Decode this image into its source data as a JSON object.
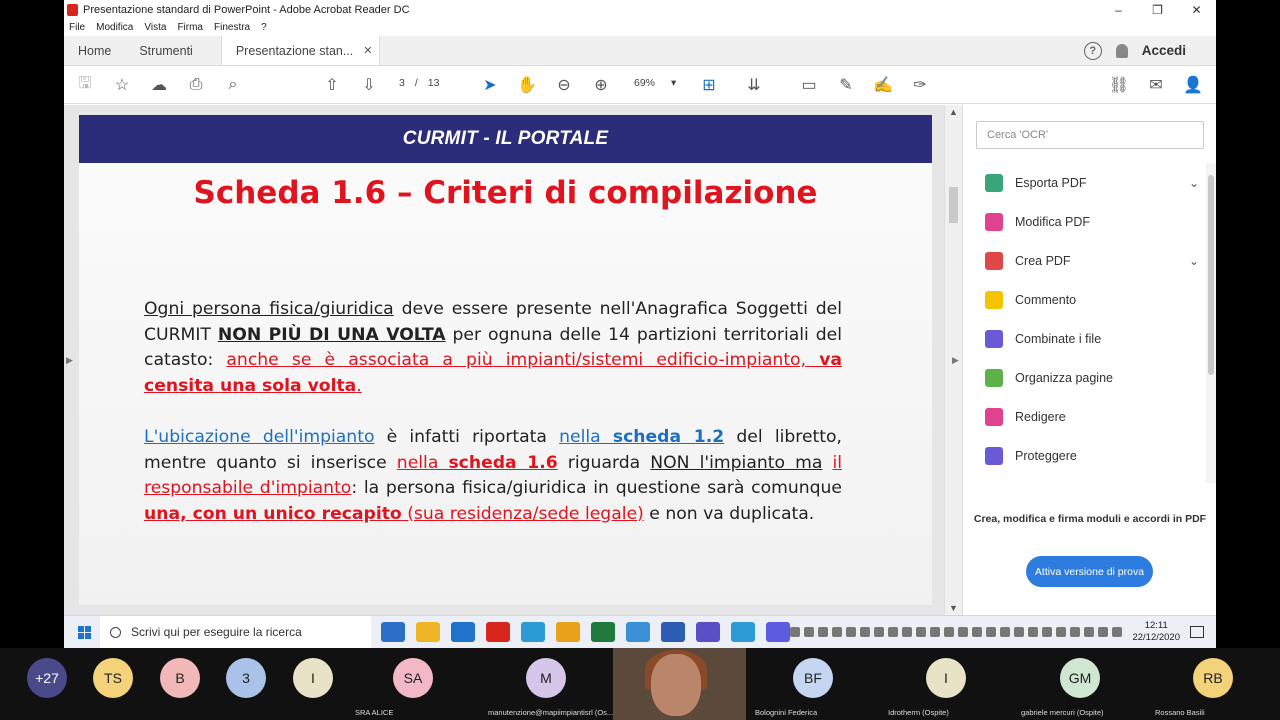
{
  "window": {
    "title": "Presentazione standard di PowerPoint - Adobe Acrobat Reader DC",
    "buttons": [
      "–",
      "❐",
      "✕"
    ]
  },
  "menu": [
    "File",
    "Modifica",
    "Vista",
    "Firma",
    "Finestra",
    "?"
  ],
  "tabs": {
    "home": "Home",
    "tools": "Strumenti",
    "document": "Presentazione stan...",
    "close": "✕",
    "help": "?",
    "login": "Accedi"
  },
  "toolbar": {
    "current_page": "3",
    "page_sep": "/",
    "total_pages": "13",
    "zoom": "69%",
    "zoom_arrow": "▾"
  },
  "slide": {
    "header": "CURMIT - IL PORTALE",
    "title_part1": "Scheda 1.6 – ",
    "title_part2": "Criteri di compilazione",
    "p1": {
      "s1": "Ogni persona fisica/giuridica",
      "s2": " deve essere presente nell'Anagrafica Soggetti del CURMIT ",
      "s3": "NON PIÙ DI UNA VOLTA",
      "s4": " per ognuna delle 14 partizioni territoriali del catasto: ",
      "s5": "anche se è associata a più impianti/sistemi edificio-impianto, ",
      "s6": "va censita una sola volta",
      "s7": "."
    },
    "p2": {
      "s1": "L'ubicazione dell'impianto",
      "s2": " è infatti riportata ",
      "s3": "nella ",
      "s4": "scheda 1.2",
      "s5": " del libretto, mentre quanto si inserisce ",
      "s6": "nella ",
      "s7": "scheda 1.6",
      "s8": " riguarda ",
      "s9": "NON l'impianto ma",
      "s10": " ",
      "s11": "il responsabile d'impianto",
      "s12": ": la persona fisica/giuridica in questione   sarà comunque ",
      "s13": "una, con un unico recapito",
      "s14": " (sua residenza/sede legale)",
      "s15": " e non va duplicata."
    }
  },
  "right_panel": {
    "search_placeholder": "Cerca 'OCR'",
    "tools": [
      {
        "label": "Esporta PDF",
        "color": "#3aa57a",
        "chevron": "⌄"
      },
      {
        "label": "Modifica PDF",
        "color": "#e0428e",
        "chevron": ""
      },
      {
        "label": "Crea PDF",
        "color": "#e04848",
        "chevron": "⌄"
      },
      {
        "label": "Commento",
        "color": "#f5c400",
        "chevron": ""
      },
      {
        "label": "Combinate i file",
        "color": "#6a5ad6",
        "chevron": ""
      },
      {
        "label": "Organizza pagine",
        "color": "#5db24a",
        "chevron": ""
      },
      {
        "label": "Redigere",
        "color": "#e0428e",
        "chevron": ""
      },
      {
        "label": "Proteggere",
        "color": "#6a5ad6",
        "chevron": ""
      }
    ],
    "promo": "Crea, modifica e firma moduli e accordi in PDF",
    "trial_button": "Attiva versione di prova"
  },
  "taskbar": {
    "search_placeholder": "Scrivi qui per eseguire la ricerca",
    "apps": [
      "#2c6fc8",
      "#f0b429",
      "#1f73c9",
      "#d7261d",
      "#2b9bd6",
      "#e8a21a",
      "#1e7a3d",
      "#3b8fd6",
      "#2b5db3",
      "#5a4fc4",
      "#2c9bd6",
      "#5c5ce0"
    ],
    "time": "12:11",
    "date": "22/12/2020"
  },
  "participants": [
    {
      "initials": "+27",
      "color": "#4a4a8a",
      "text": "#ffffff",
      "name": ""
    },
    {
      "initials": "TS",
      "color": "#f3d27a",
      "text": "#222222",
      "name": ""
    },
    {
      "initials": "B",
      "color": "#f2b8b8",
      "text": "#222222",
      "name": ""
    },
    {
      "initials": "3",
      "color": "#a9c3e8",
      "text": "#222222",
      "name": ""
    },
    {
      "initials": "I",
      "color": "#e8e3c6",
      "text": "#222222",
      "name": ""
    },
    {
      "initials": "SA",
      "color": "#f2b8c6",
      "text": "#222222",
      "name": "SRA ALICE"
    },
    {
      "initials": "M",
      "color": "#d6c6ea",
      "text": "#222222",
      "name": "manutenzione@mapiimpiantisrl (Os..."
    },
    {
      "initials": "BF",
      "color": "#c4d6f2",
      "text": "#222222",
      "name": "Bolognini Federica"
    },
    {
      "initials": "I",
      "color": "#e8e3c6",
      "text": "#222222",
      "name": "Idrotherm (Ospite)"
    },
    {
      "initials": "GM",
      "color": "#cfe6d0",
      "text": "#222222",
      "name": "gabriele mercuri (Ospite)"
    },
    {
      "initials": "RB",
      "color": "#f3d27a",
      "text": "#222222",
      "name": "Rossano Basili"
    }
  ]
}
